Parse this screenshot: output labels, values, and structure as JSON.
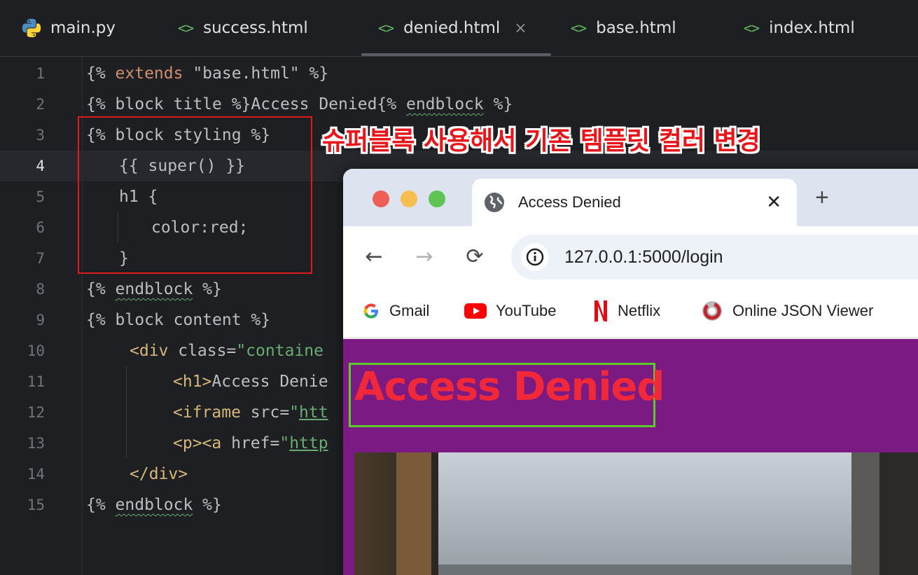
{
  "editor_tabs": [
    {
      "label": "main.py",
      "icon": "python-icon"
    },
    {
      "label": "success.html",
      "icon": "html-icon"
    },
    {
      "label": "denied.html",
      "icon": "html-icon",
      "active": true
    },
    {
      "label": "base.html",
      "icon": "html-icon"
    },
    {
      "label": "index.html",
      "icon": "html-icon"
    }
  ],
  "tab_icons": {
    "html": "<>",
    "close": "×"
  },
  "line_numbers": [
    "1",
    "2",
    "3",
    "4",
    "5",
    "6",
    "7",
    "8",
    "9",
    "10",
    "11",
    "12",
    "13",
    "14",
    "15"
  ],
  "code": {
    "l1": {
      "a": "{% ",
      "b": "extends",
      "c": " \"base.html\" %}"
    },
    "l2": {
      "a": "{% block title %}Access Denied{% ",
      "b": "endblock",
      "c": " %}"
    },
    "l3": "{% block styling %}",
    "l4": "{{ super() }}",
    "l5": "h1 {",
    "l6": "color:red;",
    "l7": "}",
    "l8": {
      "a": "{% ",
      "b": "endblock",
      "c": " %}"
    },
    "l9": "{% block content %}",
    "l10": {
      "tag": "<div",
      "attr": " class=",
      "val": "\"containe"
    },
    "l11": {
      "tag": "<h1>",
      "text": "Access Denie"
    },
    "l12": {
      "tag": "<iframe",
      "attr": " src=",
      "q": "\"",
      "link": "htt"
    },
    "l13": {
      "tag": "<p><a",
      "attr": " href=",
      "q": "\"",
      "link": "http"
    },
    "l14": "</div>",
    "l15": {
      "a": "{% ",
      "b": "endblock",
      "c": " %}"
    }
  },
  "annotation": "슈퍼블록 사용해서 기존 템플릿 컬러 변경",
  "browser": {
    "tab_title": "Access Denied",
    "tab_close": "✕",
    "new_tab": "+",
    "back": "←",
    "forward": "→",
    "reload": "⟳",
    "url": "127.0.0.1:5000/login",
    "bookmarks": [
      {
        "label": "Gmail",
        "icon": "google-icon"
      },
      {
        "label": "YouTube",
        "icon": "youtube-icon"
      },
      {
        "label": "Netflix",
        "icon": "netflix-icon"
      },
      {
        "label": "Online JSON Viewer",
        "icon": "json-viewer-icon"
      }
    ],
    "page_heading": "Access Denied",
    "page_bg": "#7a1a82",
    "heading_color": "#f0283a"
  }
}
